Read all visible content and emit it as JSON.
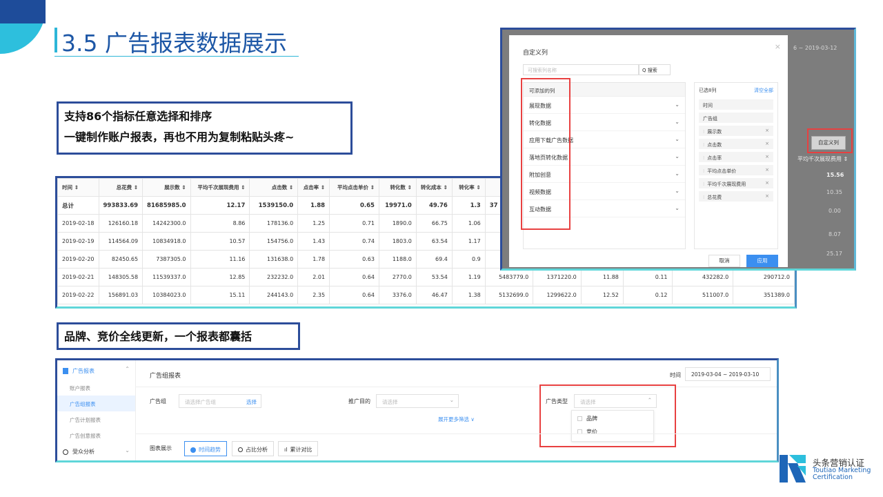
{
  "slide": {
    "title": "3.5 广告报表数据展示",
    "callout1_line1": "支持86个指标任意选择和排序",
    "callout1_line2": "一键制作账户报表，再也不用为复制粘贴头疼~",
    "callout2": "品牌、竞价全线更新，一个报表都囊括"
  },
  "report_table": {
    "headers": [
      "时间 ⇕",
      "总花费 ⇕",
      "展示数 ⇕",
      "平均千次展现费用 ⇕",
      "点击数 ⇕",
      "点击率 ⇕",
      "平均点击单价 ⇕",
      "转化数 ⇕",
      "转化成本 ⇕",
      "转化率 ⇕"
    ],
    "total": [
      "总计",
      "993833.69",
      "81685985.0",
      "12.17",
      "1539150.0",
      "1.88",
      "0.65",
      "19971.0",
      "49.76",
      "1.3",
      "37"
    ],
    "rows": [
      [
        "2019-02-18",
        "126160.18",
        "14242300.0",
        "8.86",
        "178136.0",
        "1.25",
        "0.71",
        "1890.0",
        "66.75",
        "1.06",
        "",
        "",
        "",
        "",
        "",
        ""
      ],
      [
        "2019-02-19",
        "114564.09",
        "10834918.0",
        "10.57",
        "154756.0",
        "1.43",
        "0.74",
        "1803.0",
        "63.54",
        "1.17",
        "",
        "",
        "",
        "",
        "",
        ""
      ],
      [
        "2019-02-20",
        "82450.65",
        "7387305.0",
        "11.16",
        "131638.0",
        "1.78",
        "0.63",
        "1188.0",
        "69.4",
        "0.9",
        "",
        "",
        "",
        "",
        "",
        ""
      ],
      [
        "2019-02-21",
        "148305.58",
        "11539337.0",
        "12.85",
        "232232.0",
        "2.01",
        "0.64",
        "2770.0",
        "53.54",
        "1.19",
        "5483779.0",
        "1371220.0",
        "11.88",
        "0.11",
        "432282.0",
        "290712.0"
      ],
      [
        "2019-02-22",
        "156891.03",
        "10384023.0",
        "15.11",
        "244143.0",
        "2.35",
        "0.64",
        "3376.0",
        "46.47",
        "1.38",
        "5132699.0",
        "1299622.0",
        "12.52",
        "0.12",
        "511007.0",
        "351389.0"
      ]
    ]
  },
  "modal": {
    "title": "自定义列",
    "close": "×",
    "search_placeholder": "可搜索列名称",
    "search_button": "Q 搜索",
    "left_header": "可添加的列",
    "left_items": [
      "展现数据",
      "转化数据",
      "应用下载广告数据",
      "落地页转化数据",
      "附加创意",
      "视频数据",
      "互动数据"
    ],
    "right_header": "已选8列",
    "clear_all": "清空全部",
    "selected": [
      "时间",
      "广告组",
      "展示数",
      "点击数",
      "点击率",
      "平均点击单价",
      "平均千次展现费用",
      "总花费"
    ],
    "cancel": "取消",
    "apply": "应用",
    "custom_column_button": "自定义列",
    "bg_date": "6 ~ 2019-03-12",
    "bg_header": "平均千次展现费用 ⇕",
    "bg_values": [
      "15.56",
      "10.35",
      "0.00",
      "8.07",
      "25.17"
    ]
  },
  "ad_panel": {
    "sidebar_head": "广告报表",
    "sidebar_items": [
      "账户报表",
      "广告组报表",
      "广告计划报表",
      "广告创意报表"
    ],
    "sidebar_head2": "受众分析",
    "page_title": "广告组报表",
    "time_label": "时间",
    "time_value": "2019-03-04 ~ 2019-03-10",
    "group_label": "广告组",
    "group_placeholder": "请选择广告组",
    "group_select": "选择",
    "purpose_label": "推广目的",
    "purpose_placeholder": "请选择",
    "type_label": "广告类型",
    "type_placeholder": "请选择",
    "type_options": [
      "品牌",
      "竞价"
    ],
    "expand_more": "展开更多筛选 ∨",
    "chart_label": "图表展示",
    "tabs": [
      "时间趋势",
      "占比分析",
      "累计对比"
    ]
  },
  "logo": {
    "cn": "头条营销认证",
    "en_line1": "Toutiao Marketing",
    "en_line2": "Certification"
  },
  "colors": {
    "title_blue": "#1d57a6",
    "accent_cyan": "#2db6d8",
    "frame_navy": "#2c4d9a",
    "highlight_red": "#e84040",
    "link_blue": "#3b8ff0"
  }
}
